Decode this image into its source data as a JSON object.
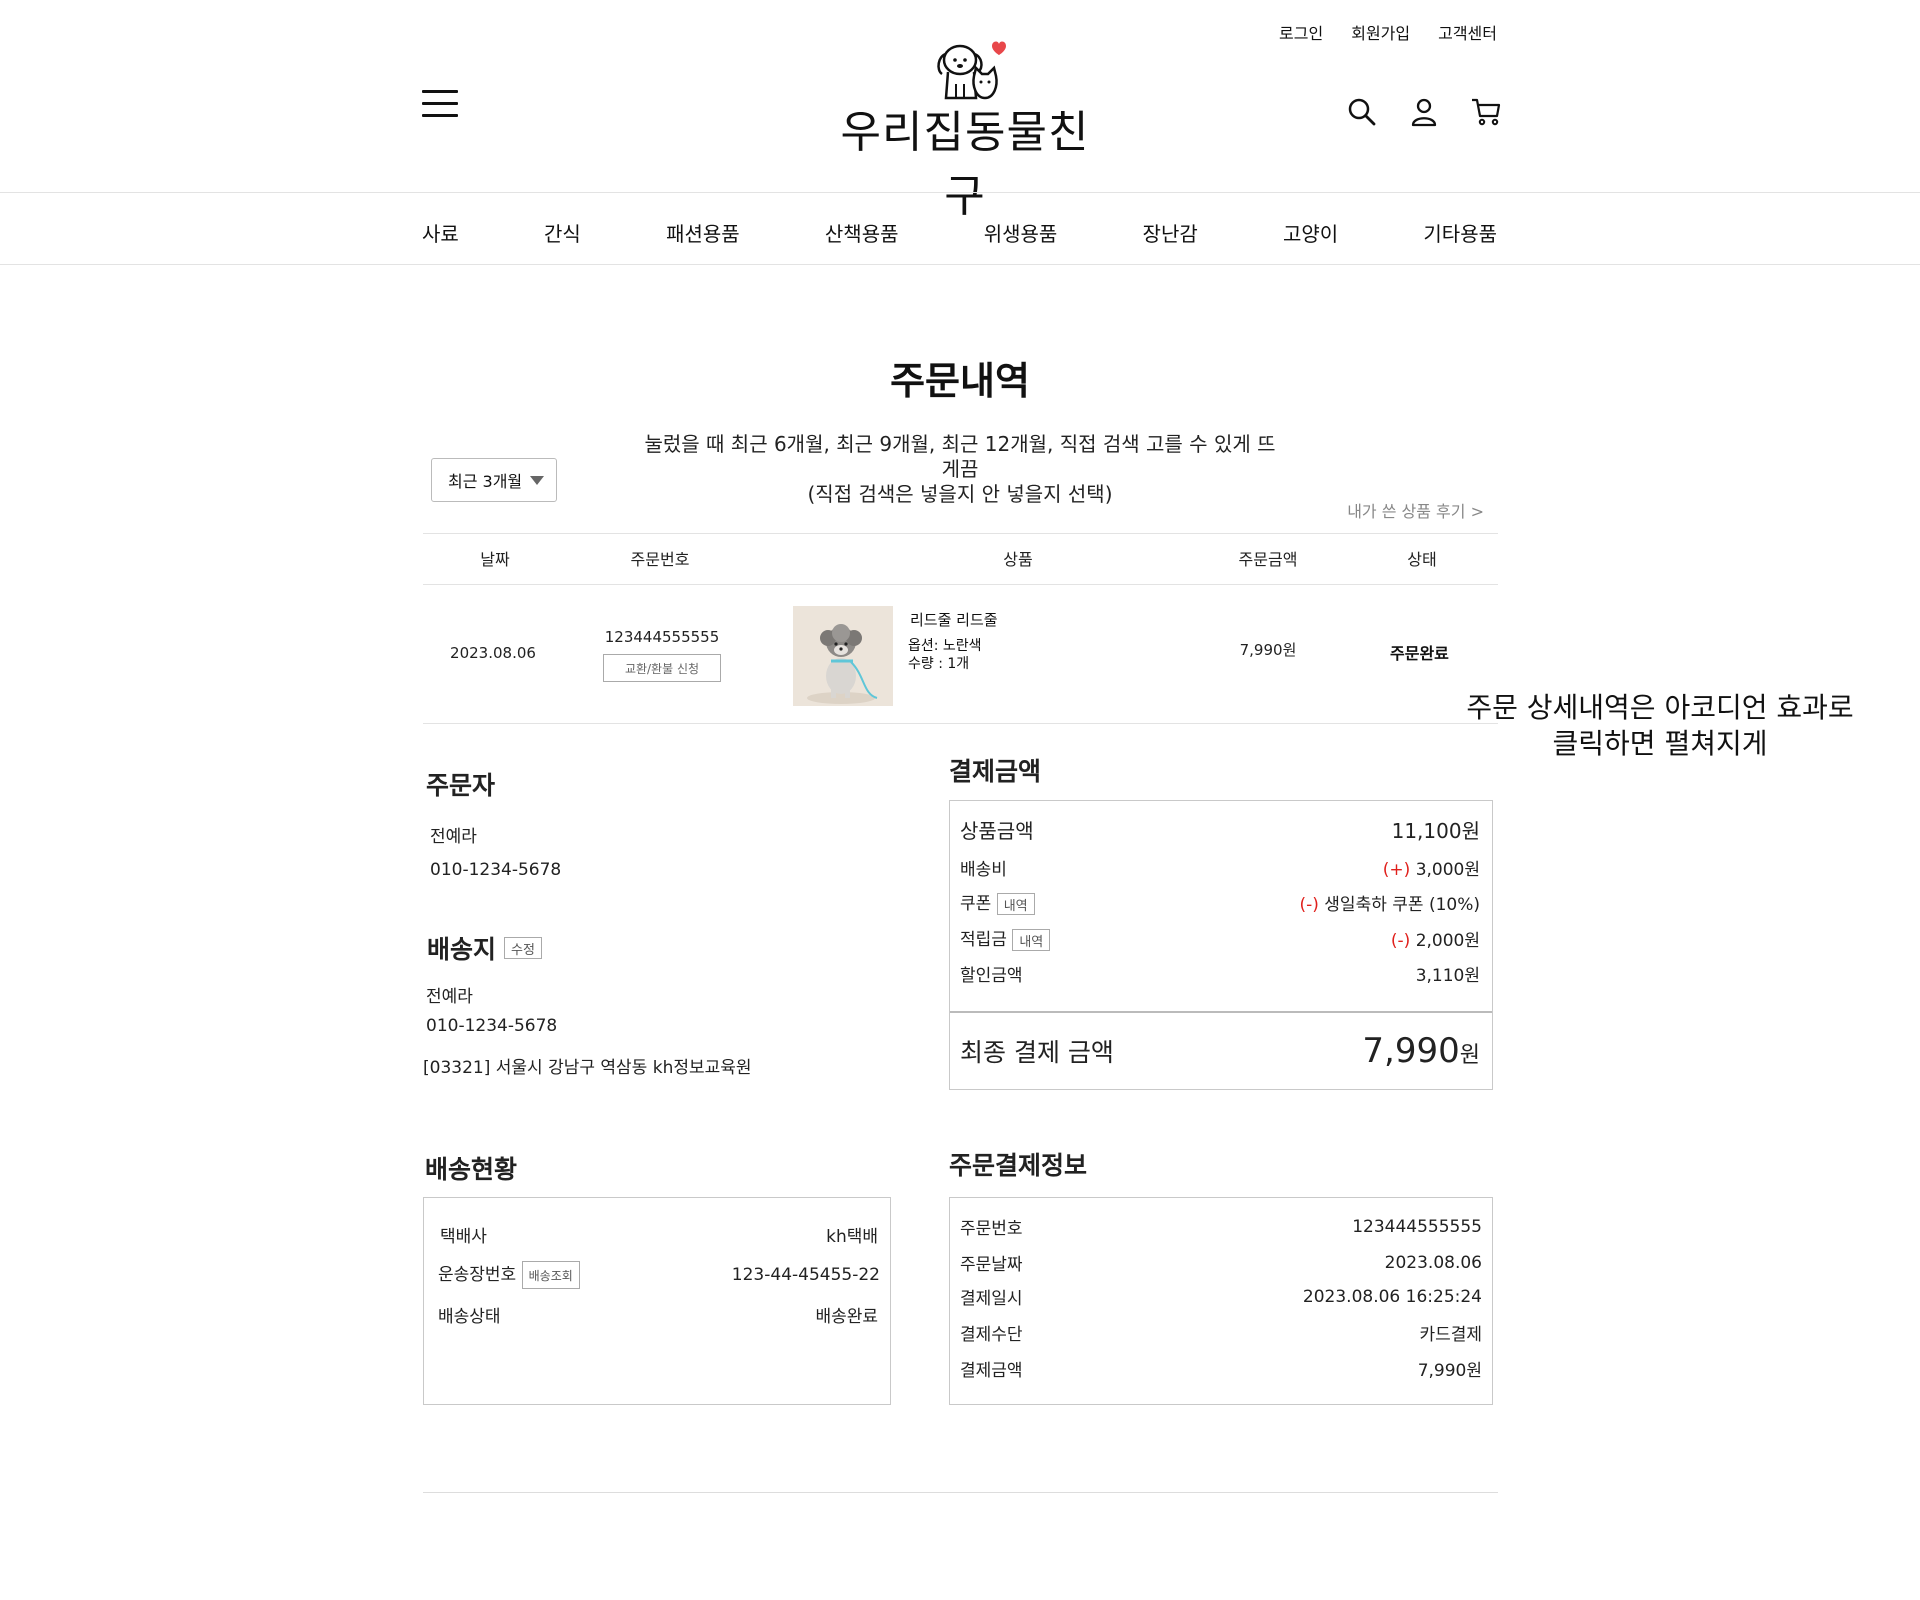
{
  "header": {
    "top_links": [
      "로그인",
      "회원가입",
      "고객센터"
    ],
    "logo_text": "우리집동물친구",
    "icons": [
      "search-icon",
      "user-icon",
      "cart-icon",
      "hamburger-menu-icon"
    ]
  },
  "nav": {
    "items": [
      "사료",
      "간식",
      "패션용품",
      "산책용품",
      "위생용품",
      "장난감",
      "고양이",
      "기타용품"
    ]
  },
  "page": {
    "title": "주문내역",
    "note_line1": "눌렀을 때 최근 6개월, 최근 9개월, 최근 12개월, 직접 검색 고를 수 있게 뜨게끔",
    "note_line2": "(직접 검색은 넣을지 안 넣을지 선택)",
    "period_select": "최근 3개월",
    "review_link": "내가 쓴 상품 후기 >"
  },
  "order_table": {
    "headers": [
      "날짜",
      "주문번호",
      "상품",
      "주문금액",
      "상태"
    ],
    "row": {
      "date": "2023.08.06",
      "order_no": "123444555555",
      "refund_button": "교환/환불 신청",
      "product_name": "리드줄 리드줄",
      "option": "옵션: 노란색",
      "quantity": "수량 : 1개",
      "amount": "7,990원",
      "status": "주문완료"
    }
  },
  "annotation": {
    "line1": "주문 상세내역은 아코디언 효과로",
    "line2": "클릭하면 펼쳐지게"
  },
  "orderer": {
    "title": "주문자",
    "name": "전예라",
    "phone": "010-1234-5678"
  },
  "delivery": {
    "title": "배송지",
    "edit_button": "수정",
    "name": "전예라",
    "phone": "010-1234-5678",
    "address": "[03321] 서울시 강남구 역삼동 kh정보교육원"
  },
  "payment": {
    "title": "결제금액",
    "product_amount_label": "상품금액",
    "product_amount": "11,100원",
    "shipping_label": "배송비",
    "shipping_sign": "(+)",
    "shipping_value": "3,000원",
    "coupon_label": "쿠폰",
    "coupon_button": "내역",
    "coupon_sign": "(-)",
    "coupon_value": "생일축하 쿠폰 (10%)",
    "points_label": "적립금",
    "points_button": "내역",
    "points_sign": "(-)",
    "points_value": "2,000원",
    "discount_label": "할인금액",
    "discount_value": "3,110원",
    "final_label": "최종 결제 금액",
    "final_value": "7,990",
    "final_unit": "원"
  },
  "shipping_status": {
    "title": "배송현황",
    "carrier_label": "택배사",
    "carrier_value": "kh택배",
    "tracking_label": "운송장번호",
    "tracking_button": "배송조회",
    "tracking_value": "123-44-45455-22",
    "status_label": "배송상태",
    "status_value": "배송완료"
  },
  "order_payment_info": {
    "title": "주문결제정보",
    "rows": [
      {
        "label": "주문번호",
        "value": "123444555555"
      },
      {
        "label": "주문날짜",
        "value": "2023.08.06"
      },
      {
        "label": "결제일시",
        "value": "2023.08.06 16:25:24"
      },
      {
        "label": "결제수단",
        "value": "카드결제"
      },
      {
        "label": "결제금액",
        "value": "7,990원"
      }
    ]
  },
  "colors": {
    "accent_red": "#e0201c",
    "logo_heart": "#e8474a"
  }
}
